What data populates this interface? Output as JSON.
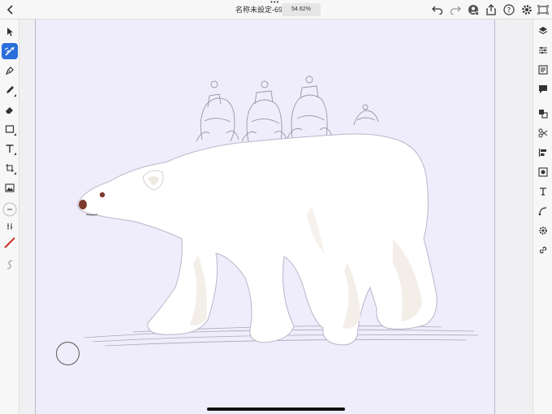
{
  "app": {
    "document_title": "名称未設定-69",
    "zoom_level": "54.62%"
  },
  "colors": {
    "accent": "#2a6fdb",
    "artboard_bg": "#efedfb",
    "brush_red": "#c8352e",
    "bear_nose": "#7a3b2e"
  },
  "left_toolbar": {
    "tools": [
      {
        "name": "select-arrow-icon"
      },
      {
        "name": "pixel-brush-icon",
        "active": true
      },
      {
        "name": "pen-nib-icon"
      },
      {
        "name": "pencil-icon"
      },
      {
        "name": "eraser-icon"
      },
      {
        "name": "rectangle-shape-icon"
      },
      {
        "name": "type-text-icon"
      },
      {
        "name": "transform-icon"
      },
      {
        "name": "image-icon"
      },
      {
        "name": "stroke-size-icon"
      },
      {
        "name": "stroke-options-icon"
      },
      {
        "name": "color-swatch-icon"
      },
      {
        "name": "smooth-curve-icon"
      }
    ]
  },
  "right_toolbar": {
    "tools": [
      "layers-icon",
      "properties-sliders-icon",
      "libraries-icon",
      "comments-icon",
      "arrange-icon",
      "scissors-icon",
      "align-icon",
      "image-trace-icon",
      "text-type-icon",
      "shape-curve-icon",
      "repeat-gear-icon",
      "link-icon"
    ]
  }
}
